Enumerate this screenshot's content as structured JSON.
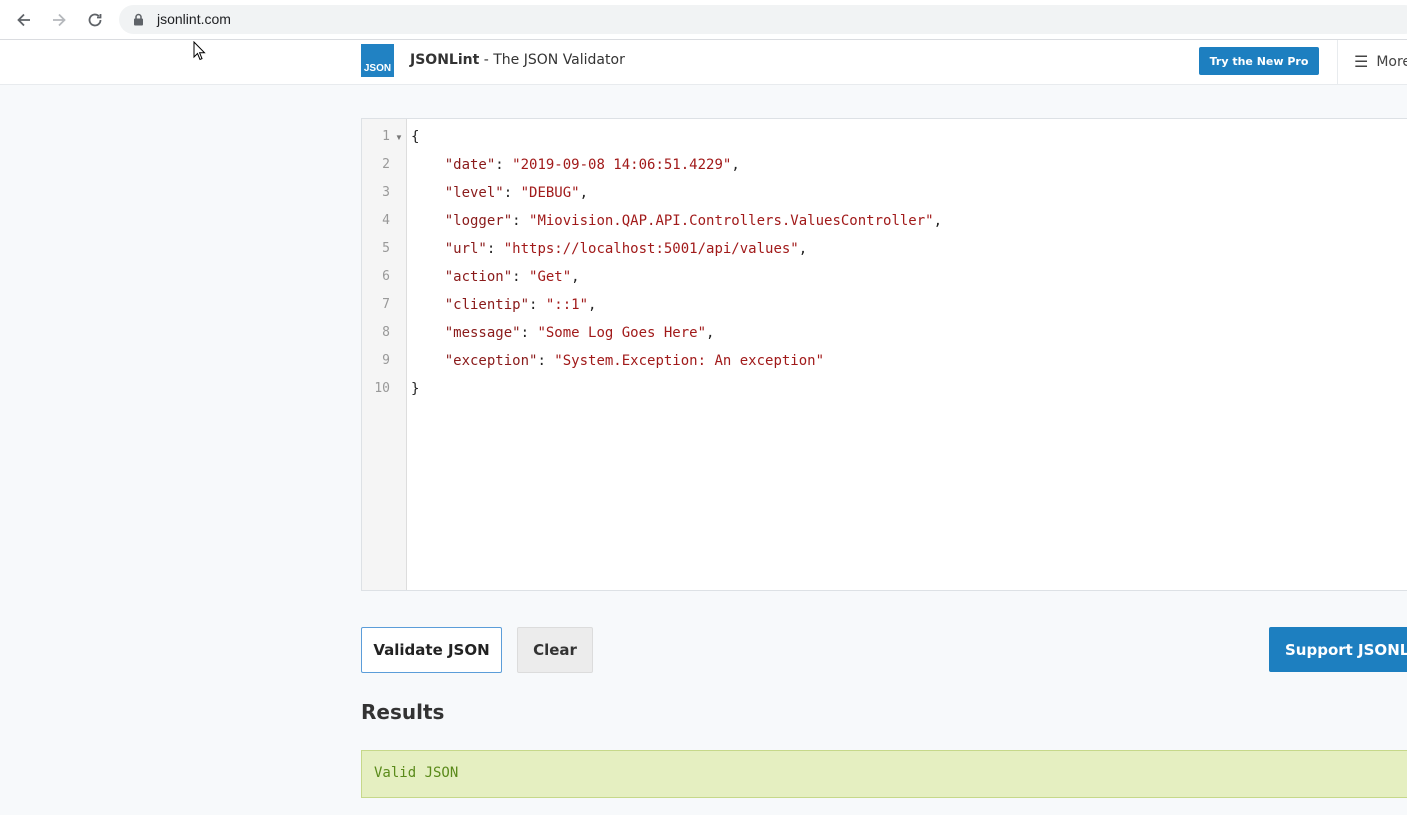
{
  "browser": {
    "url": "jsonlint.com"
  },
  "header": {
    "logo_text": "JSON",
    "brand": "JSONLint",
    "tagline": " - The JSON Validator",
    "pro_button": "Try the New Pro",
    "more_label": "More",
    "accent_color": "#1d7fc0"
  },
  "editor": {
    "line_numbers": [
      "1",
      "2",
      "3",
      "4",
      "5",
      "6",
      "7",
      "8",
      "9",
      "10"
    ],
    "lines": [
      {
        "pre": "{",
        "key": "",
        "mid": "",
        "val": "",
        "post": ""
      },
      {
        "pre": "    ",
        "key": "\"date\"",
        "mid": ": ",
        "val": "\"2019-09-08 14:06:51.4229\"",
        "post": ","
      },
      {
        "pre": "    ",
        "key": "\"level\"",
        "mid": ": ",
        "val": "\"DEBUG\"",
        "post": ","
      },
      {
        "pre": "    ",
        "key": "\"logger\"",
        "mid": ": ",
        "val": "\"Miovision.QAP.API.Controllers.ValuesController\"",
        "post": ","
      },
      {
        "pre": "    ",
        "key": "\"url\"",
        "mid": ": ",
        "val": "\"https://localhost:5001/api/values\"",
        "post": ","
      },
      {
        "pre": "    ",
        "key": "\"action\"",
        "mid": ": ",
        "val": "\"Get\"",
        "post": ","
      },
      {
        "pre": "    ",
        "key": "\"clientip\"",
        "mid": ": ",
        "val": "\"::1\"",
        "post": ","
      },
      {
        "pre": "    ",
        "key": "\"message\"",
        "mid": ": ",
        "val": "\"Some Log Goes Here\"",
        "post": ","
      },
      {
        "pre": "    ",
        "key": "\"exception\"",
        "mid": ": ",
        "val": "\"System.Exception: An exception\"",
        "post": ""
      },
      {
        "pre": "}",
        "key": "",
        "mid": "",
        "val": "",
        "post": ""
      }
    ]
  },
  "actions": {
    "validate": "Validate JSON",
    "clear": "Clear",
    "support": "Support JSONLint"
  },
  "results": {
    "heading": "Results",
    "message": "Valid JSON"
  }
}
